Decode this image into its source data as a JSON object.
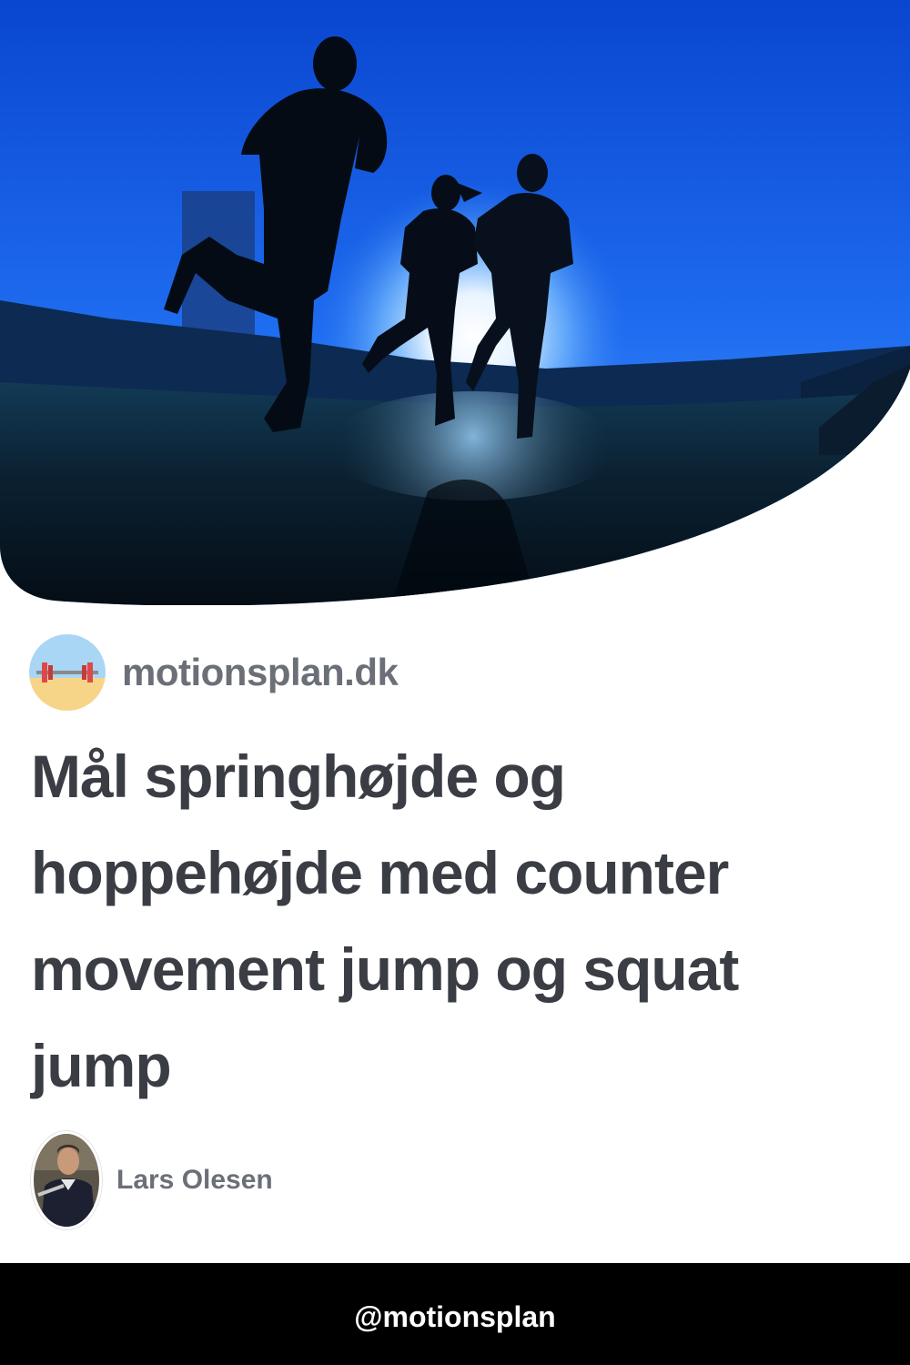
{
  "hero": {
    "icon": "runners-silhouette-photo"
  },
  "site": {
    "icon": "barbell-icon",
    "name": "motionsplan.dk"
  },
  "article": {
    "title": "Mål springhøjde og hoppehøjde med counter movement jump og squat jump"
  },
  "author": {
    "icon": "author-photo",
    "name": "Lars Olesen"
  },
  "footer": {
    "handle": "@motionsplan"
  },
  "colors": {
    "sky_top": "#0a4fd6",
    "sky_bottom": "#3f8cff",
    "title_text": "#3a3d44",
    "muted_text": "#6b6f78",
    "footer_bg": "#000000"
  }
}
